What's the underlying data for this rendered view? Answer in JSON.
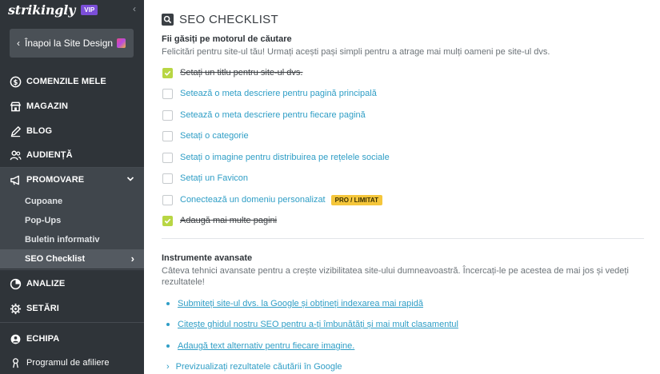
{
  "brand": {
    "logo": "strikingly",
    "badge": "VIP"
  },
  "sidebar": {
    "back_label": "Înapoi la Site Design",
    "items": [
      {
        "label": "COMENZILE MELE",
        "icon": "dollar-circle-icon"
      },
      {
        "label": "MAGAZIN",
        "icon": "store-icon"
      },
      {
        "label": "BLOG",
        "icon": "pen-icon"
      },
      {
        "label": "AUDIENȚĂ",
        "icon": "people-icon"
      },
      {
        "label": "PROMOVARE",
        "icon": "megaphone-icon"
      }
    ],
    "submenu": [
      "Cupoane",
      "Pop-Ups",
      "Buletin informativ",
      "SEO Checklist"
    ],
    "items2": [
      {
        "label": "ANALIZE",
        "icon": "pie-chart-icon"
      },
      {
        "label": "SETĂRI",
        "icon": "gear-icon"
      },
      {
        "label": "ECHIPA",
        "icon": "team-icon"
      },
      {
        "label": "Programul de afiliere",
        "icon": "affiliate-icon"
      }
    ]
  },
  "main": {
    "title": "SEO CHECKLIST",
    "section1_title": "Fii găsiți pe motorul de căutare",
    "section1_desc": "Felicitări pentru site-ul tău! Urmați acești pași simpli pentru a atrage mai mulți oameni pe site-ul dvs.",
    "checklist": [
      {
        "label": "Setați un titlu pentru site-ul dvs.",
        "done": true
      },
      {
        "label": "Setează o meta descriere pentru pagină principală",
        "done": false
      },
      {
        "label": "Setează o meta descriere pentru fiecare pagină",
        "done": false
      },
      {
        "label": "Setați o categorie",
        "done": false
      },
      {
        "label": "Setați o imagine pentru distribuirea pe rețelele sociale",
        "done": false
      },
      {
        "label": "Setați un Favicon",
        "done": false
      },
      {
        "label": "Conectează un domeniu personalizat",
        "done": false,
        "badge": "PRO / LIMITAT"
      },
      {
        "label": "Adaugă mai multe pagini",
        "done": true
      }
    ],
    "section2_title": "Instrumente avansate",
    "section2_desc": "Câteva tehnici avansate pentru a crește vizibilitatea site-ului dumneavoastră. Încercați-le pe acestea de mai jos și vedeți rezultatele!",
    "tools": [
      "Submiteți site-ul dvs. la Google și obțineți indexarea mai rapidă",
      "Citește ghidul nostru SEO pentru a-ți îmbunătăți și mai mult clasamentul",
      "Adaugă text alternativ pentru fiecare imagine."
    ],
    "preview_label": "Previzualizați rezultatele căutării în Google"
  },
  "colors": {
    "sidebar": "#2f3439",
    "accent": "#2f9ec6",
    "check": "#b8d644",
    "badge": "#f5c63b",
    "vip": "#7b4ed8"
  }
}
